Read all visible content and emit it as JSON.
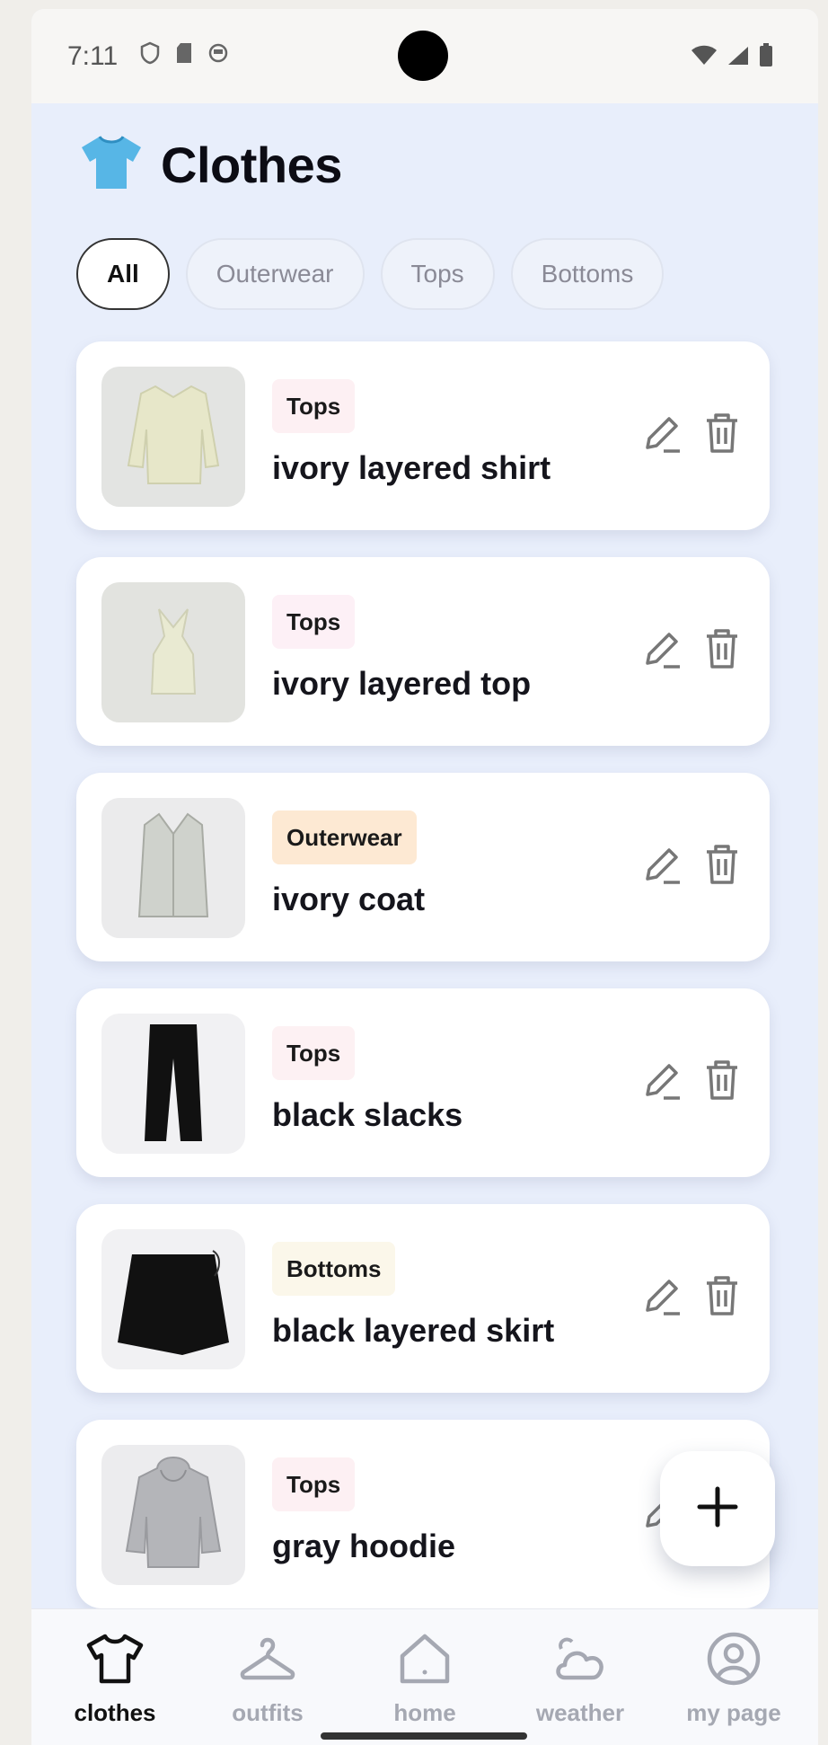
{
  "status": {
    "time": "7:11"
  },
  "header": {
    "title": "Clothes",
    "icon": "tshirt-emoji-icon"
  },
  "filters": [
    {
      "label": "All",
      "active": true
    },
    {
      "label": "Outerwear",
      "active": false
    },
    {
      "label": "Tops",
      "active": false
    },
    {
      "label": "Bottoms",
      "active": false
    }
  ],
  "items": [
    {
      "category": "Tops",
      "name": "ivory layered shirt",
      "tag_color": "#fdf0f3"
    },
    {
      "category": "Tops",
      "name": "ivory layered top",
      "tag_color": "#fdf0f6"
    },
    {
      "category": "Outerwear",
      "name": "ivory coat",
      "tag_color": "#fde9d3"
    },
    {
      "category": "Tops",
      "name": "black slacks",
      "tag_color": "#fdf1f3"
    },
    {
      "category": "Bottoms",
      "name": "black layered skirt",
      "tag_color": "#fbf7ea"
    },
    {
      "category": "Tops",
      "name": "gray hoodie",
      "tag_color": "#fdf0f3"
    }
  ],
  "fab": {
    "icon": "plus-icon"
  },
  "nav": [
    {
      "label": "clothes",
      "icon": "tshirt-icon",
      "active": true
    },
    {
      "label": "outfits",
      "icon": "hanger-icon",
      "active": false
    },
    {
      "label": "home",
      "icon": "home-icon",
      "active": false
    },
    {
      "label": "weather",
      "icon": "cloud-sun-icon",
      "active": false
    },
    {
      "label": "my page",
      "icon": "user-circle-icon",
      "active": false
    }
  ],
  "colors": {
    "background": "#e8eefb",
    "card": "#ffffff",
    "active_nav": "#111111",
    "inactive_nav": "#a5a8b2"
  }
}
